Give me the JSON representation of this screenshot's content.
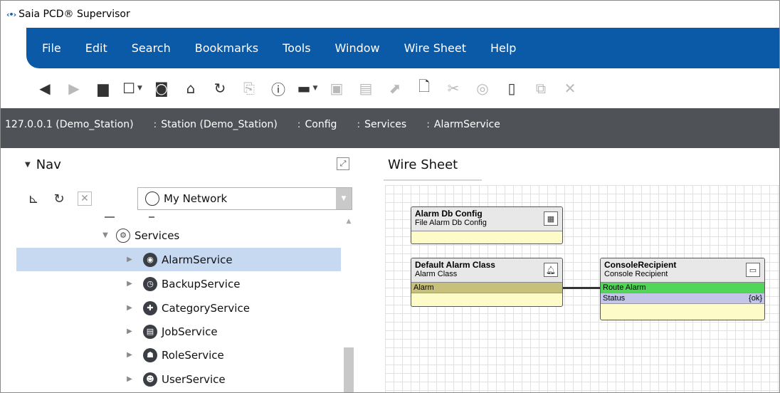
{
  "app": {
    "title": "Saia PCD® Supervisor",
    "logo": "‹•›"
  },
  "menu": [
    "File",
    "Edit",
    "Search",
    "Bookmarks",
    "Tools",
    "Window",
    "Wire Sheet",
    "Help"
  ],
  "toolbar": {
    "back_icon": "back-arrow-icon",
    "forward_icon": "forward-arrow-icon"
  },
  "breadcrumb": {
    "host": "127.0.0.1 (Demo_Station)",
    "items": [
      "Station (Demo_Station)",
      "Config",
      "Services",
      "AlarmService"
    ],
    "separator": ":"
  },
  "nav": {
    "title": "Nav",
    "network_select": "My Network",
    "tree": {
      "parent": "Services",
      "children": [
        "AlarmService",
        "BackupService",
        "CategoryService",
        "JobService",
        "RoleService",
        "UserService"
      ],
      "selected": "AlarmService"
    }
  },
  "wiresheet": {
    "tab": "Wire Sheet",
    "components": {
      "alarm_db": {
        "name": "Alarm Db Config",
        "type": "File Alarm Db Config"
      },
      "alarm_class": {
        "name": "Default Alarm Class",
        "type": "Alarm Class",
        "slot": "Alarm"
      },
      "console": {
        "name": "ConsoleRecipient",
        "type": "Console Recipient",
        "slot1": "Route Alarm",
        "slot2": "Status",
        "slot2_value": "{ok}"
      }
    }
  },
  "colors": {
    "menubar": "#0b5aa8",
    "breadcrumb": "#4f5257",
    "selected_row": "#c7d9f1"
  }
}
